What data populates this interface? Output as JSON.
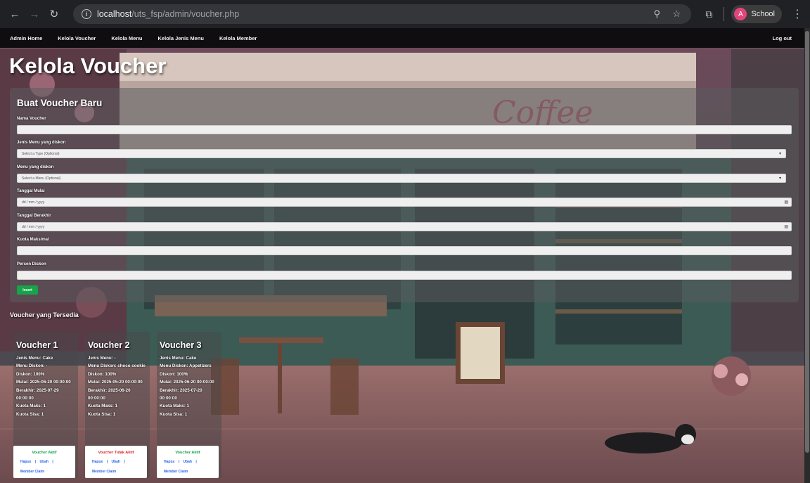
{
  "browser": {
    "url_host": "localhost",
    "url_path": "/uts_fsp/admin/voucher.php",
    "profile_initial": "A",
    "profile_name": "School"
  },
  "nav": {
    "items": [
      "Admin Home",
      "Kelola Voucher",
      "Kelola Menu",
      "Kelola Jenis Menu",
      "Kelola Member"
    ],
    "logout": "Log out"
  },
  "page": {
    "title": "Kelola Voucher"
  },
  "form": {
    "title": "Buat Voucher Baru",
    "nama_label": "Nama Voucher",
    "jenis_label": "Jenis Menu yang diskon",
    "jenis_placeholder": "Select a Type (Optional)",
    "menu_label": "Menu yang diskon",
    "menu_placeholder": "Select a Menu (Optional)",
    "mulai_label": "Tanggal Mulai",
    "mulai_placeholder": "dd / mm / yyyy",
    "berakhir_label": "Tanggal Berakhir",
    "berakhir_placeholder": "dd / mm / yyyy",
    "kuota_label": "Kuota Maksimal",
    "persen_label": "Persen Diskon",
    "submit": "Insert"
  },
  "vouchers_section": {
    "title": "Voucher yang Tersedia"
  },
  "vouchers": [
    {
      "title": "Voucher 1",
      "jenis": "Jenis Menu: Cake",
      "menu": "Menu Diskon: -",
      "diskon": "Diskon: 100%",
      "mulai": "Mulai: 2025-06-20 00:00:00",
      "berakhir": "Berakhir: 2025-07-29 00:00:00",
      "kuota_maks": "Kuota Maks: 1",
      "kuota_sisa": "Kuota Sisa: 1",
      "status": "Voucher Aktif",
      "hapus": "Hapus",
      "ubah": "Ubah",
      "claim": "Member Claim"
    },
    {
      "title": "Voucher 2",
      "jenis": "Jenis Menu: -",
      "menu": "Menu Diskon: choco cookie",
      "diskon": "Diskon: 100%",
      "mulai": "Mulai: 2025-05-20 00:00:00",
      "berakhir": "Berakhir: 2025-06-20 00:00:00",
      "kuota_maks": "Kuota Maks: 1",
      "kuota_sisa": "Kuota Sisa: 1",
      "status": "Voucher Tidak Aktif",
      "hapus": "Hapus",
      "ubah": "Ubah",
      "claim": "Member Claim"
    },
    {
      "title": "Voucher 3",
      "jenis": "Jenis Menu: Cake",
      "menu": "Menu Diskon: Appetizers",
      "diskon": "Diskon: 100%",
      "mulai": "Mulai: 2025-06-20 00:00:00",
      "berakhir": "Berakhir: 2025-07-20 00:00:00",
      "kuota_maks": "Kuota Maks: 1",
      "kuota_sisa": "Kuota Sisa: 1",
      "status": "Voucher Aktif",
      "hapus": "Hapus",
      "ubah": "Ubah",
      "claim": "Member Claim"
    }
  ],
  "colors": {
    "active": "#16a34a",
    "inactive": "#dc2626",
    "link": "#2563eb",
    "insert_button": "#16a34a"
  }
}
